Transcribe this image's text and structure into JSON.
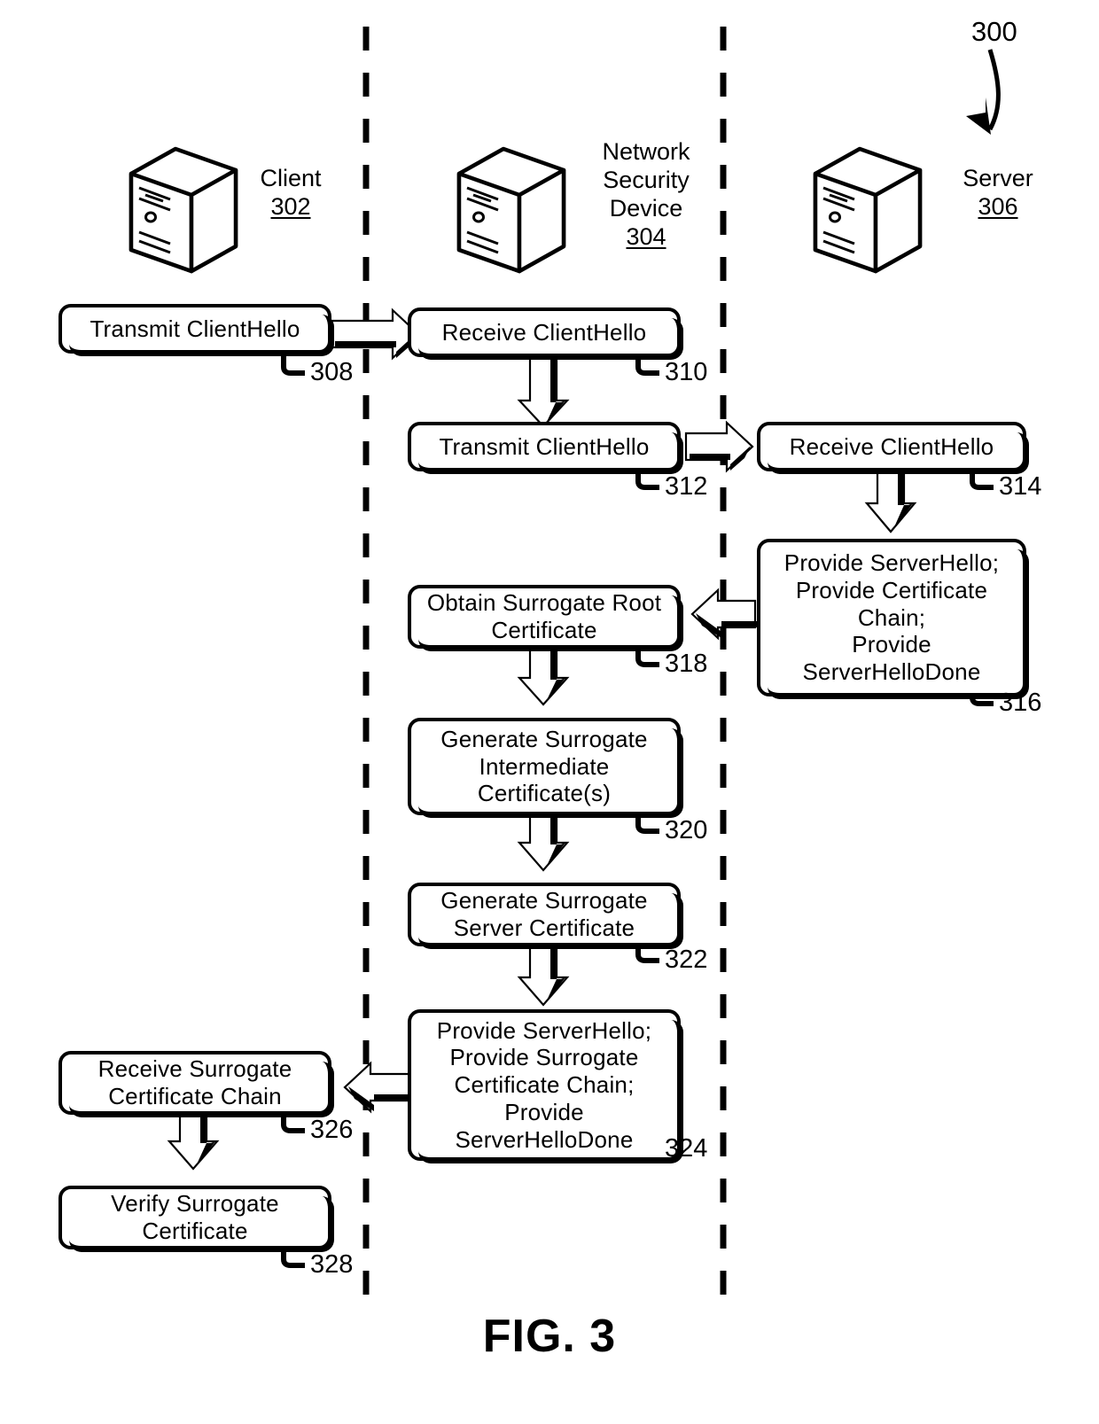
{
  "figure": {
    "caption": "FIG. 3",
    "number": "300"
  },
  "lanes": [
    {
      "id": "client",
      "title": "Client",
      "ref": "302",
      "icon": "computer-tower-icon"
    },
    {
      "id": "network-security-device",
      "title": "Network\nSecurity\nDevice",
      "title_lines": [
        "Network",
        "Security",
        "Device"
      ],
      "ref": "304",
      "icon": "computer-tower-icon"
    },
    {
      "id": "server",
      "title": "Server",
      "ref": "306",
      "icon": "computer-tower-icon"
    }
  ],
  "steps": [
    {
      "id": "s308",
      "ref": "308",
      "lane": "client",
      "lines": [
        "Transmit ClientHello"
      ]
    },
    {
      "id": "s310",
      "ref": "310",
      "lane": "nsd",
      "lines": [
        "Receive ClientHello"
      ]
    },
    {
      "id": "s312",
      "ref": "312",
      "lane": "nsd",
      "lines": [
        "Transmit ClientHello"
      ]
    },
    {
      "id": "s314",
      "ref": "314",
      "lane": "server",
      "lines": [
        "Receive ClientHello"
      ]
    },
    {
      "id": "s316",
      "ref": "316",
      "lane": "server",
      "lines": [
        "Provide ServerHello;",
        "Provide Certificate",
        "Chain;",
        "Provide",
        "ServerHelloDone"
      ]
    },
    {
      "id": "s318",
      "ref": "318",
      "lane": "nsd",
      "lines": [
        "Obtain Surrogate Root",
        "Certificate"
      ]
    },
    {
      "id": "s320",
      "ref": "320",
      "lane": "nsd",
      "lines": [
        "Generate Surrogate",
        "Intermediate",
        "Certificate(s)"
      ]
    },
    {
      "id": "s322",
      "ref": "322",
      "lane": "nsd",
      "lines": [
        "Generate Surrogate",
        "Server Certificate"
      ]
    },
    {
      "id": "s324",
      "ref": "324",
      "lane": "nsd",
      "lines": [
        "Provide ServerHello;",
        "Provide Surrogate",
        "Certificate Chain;",
        "Provide",
        "ServerHelloDone"
      ]
    },
    {
      "id": "s326",
      "ref": "326",
      "lane": "client",
      "lines": [
        "Receive Surrogate",
        "Certificate Chain"
      ]
    },
    {
      "id": "s328",
      "ref": "328",
      "lane": "client",
      "lines": [
        "Verify Surrogate",
        "Certificate"
      ]
    }
  ],
  "flows": [
    {
      "from": "s308",
      "to": "s310",
      "direction": "right"
    },
    {
      "from": "s310",
      "to": "s312",
      "direction": "down"
    },
    {
      "from": "s312",
      "to": "s314",
      "direction": "right"
    },
    {
      "from": "s314",
      "to": "s316",
      "direction": "down"
    },
    {
      "from": "s316",
      "to": "s318",
      "direction": "left"
    },
    {
      "from": "s318",
      "to": "s320",
      "direction": "down"
    },
    {
      "from": "s320",
      "to": "s322",
      "direction": "down"
    },
    {
      "from": "s322",
      "to": "s324",
      "direction": "down"
    },
    {
      "from": "s324",
      "to": "s326",
      "direction": "left"
    },
    {
      "from": "s326",
      "to": "s328",
      "direction": "down"
    }
  ],
  "colors": {
    "line": "#000000",
    "background": "#ffffff"
  }
}
